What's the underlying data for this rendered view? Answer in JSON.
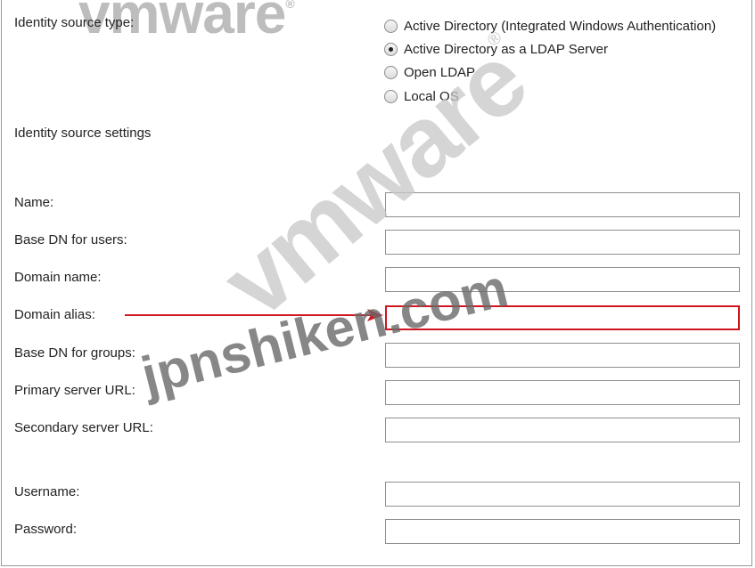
{
  "identity_source_type": {
    "label": "Identity source type:",
    "options": [
      {
        "label": "Active Directory (Integrated Windows Authentication)",
        "selected": false
      },
      {
        "label": "Active Directory as a LDAP Server",
        "selected": true
      },
      {
        "label": "Open LDAP",
        "selected": false
      },
      {
        "label": "Local OS",
        "selected": false
      }
    ]
  },
  "settings_heading": "Identity source settings",
  "fields": {
    "name": {
      "label": "Name:",
      "value": ""
    },
    "base_dn_users": {
      "label": "Base DN for users:",
      "value": ""
    },
    "domain_name": {
      "label": "Domain name:",
      "value": ""
    },
    "domain_alias": {
      "label": "Domain alias:",
      "value": ""
    },
    "base_dn_groups": {
      "label": "Base DN for groups:",
      "value": ""
    },
    "primary_server_url": {
      "label": "Primary server URL:",
      "value": ""
    },
    "secondary_server_url": {
      "label": "Secondary server URL:",
      "value": ""
    },
    "username": {
      "label": "Username:",
      "value": ""
    },
    "password": {
      "label": "Password:",
      "value": ""
    }
  },
  "watermarks": {
    "brand_top": "vmware",
    "brand_diagonal": "vmware",
    "site": "jpnshiken.com",
    "registered": "®"
  },
  "colors": {
    "highlight": "#d0161f",
    "watermark": "#c8c8c8"
  }
}
